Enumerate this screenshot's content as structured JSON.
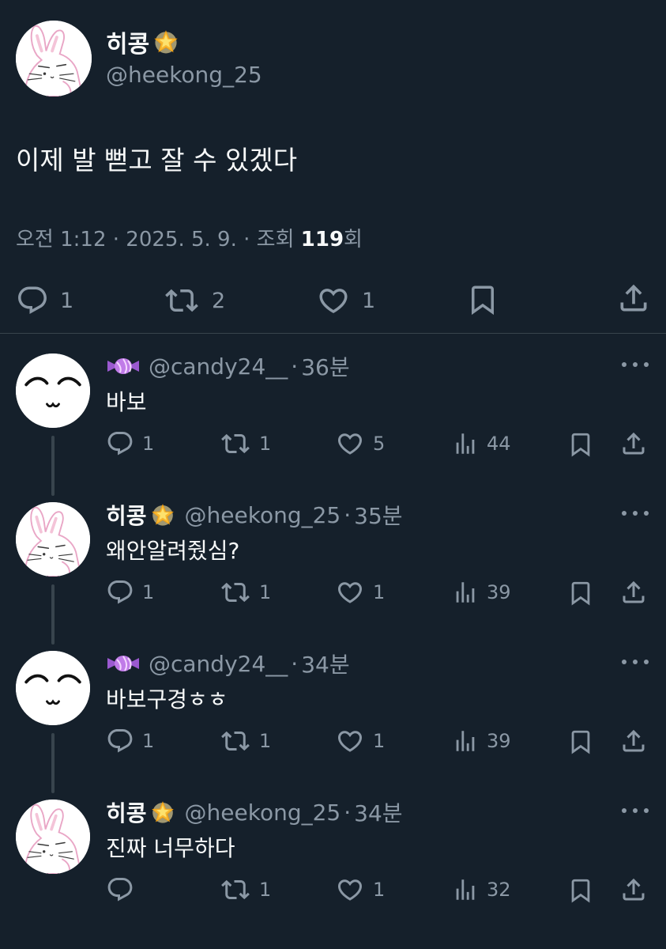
{
  "main_tweet": {
    "display_name": "히콩",
    "handle": "@heekong_25",
    "text": "이제 발 뻗고 잘 수 있겠다",
    "meta_prefix": "오전 1:12 · 2025. 5. 9. · 조회 ",
    "views": "119",
    "views_suffix": "회",
    "actions": {
      "replies": "1",
      "retweets": "2",
      "likes": "1"
    }
  },
  "replies": [
    {
      "display_name": "",
      "handle": "@candy24__",
      "time": "36분",
      "text": "바보",
      "replies": "1",
      "retweets": "1",
      "likes": "5",
      "views": "44"
    },
    {
      "display_name": "히콩",
      "handle": "@heekong_25",
      "time": "35분",
      "text": "왜안알려줬심?",
      "replies": "1",
      "retweets": "1",
      "likes": "1",
      "views": "39"
    },
    {
      "display_name": "",
      "handle": "@candy24__",
      "time": "34분",
      "text": "바보구경ㅎㅎ",
      "replies": "1",
      "retweets": "1",
      "likes": "1",
      "views": "39"
    },
    {
      "display_name": "히콩",
      "handle": "@heekong_25",
      "time": "34분",
      "text": "진짜 너무하다",
      "replies": "",
      "retweets": "1",
      "likes": "1",
      "views": "32"
    }
  ],
  "separator": "·",
  "colors": {
    "background": "#15202b",
    "text_primary": "#f7f9f9",
    "text_secondary": "#8b98a5",
    "divider": "#38444d"
  },
  "icons": [
    "reply-icon",
    "retweet-icon",
    "like-icon",
    "bookmark-icon",
    "share-icon",
    "views-icon",
    "more-icon",
    "star-emoji-icon",
    "candy-emoji-icon"
  ]
}
